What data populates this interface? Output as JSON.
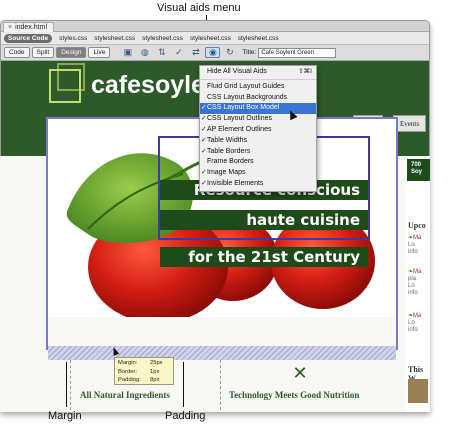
{
  "callouts": {
    "visual_aids_menu": "Visual aids menu",
    "margin": "Margin",
    "padding": "Padding"
  },
  "document": {
    "tab_title": "index.html",
    "related_files": [
      "Source Code",
      "styles.css",
      "stylesheet.css",
      "stylesheet.css",
      "stylesheet.css",
      "stylesheet.css"
    ]
  },
  "toolbar": {
    "code": "Code",
    "split": "Split",
    "design": "Design",
    "live": "Live",
    "title_label": "Title:",
    "title_value": "Cafe Soylent Green"
  },
  "site": {
    "logo": "cafesoyle",
    "nav": [
      "Menu",
      "Events"
    ],
    "headlines": [
      "Resource conscious",
      "haute cuisine",
      "for the 21st Century"
    ],
    "columns": [
      "All Natural Ingredients",
      "Technology Meets Good Nutrition"
    ],
    "sidebar_badge": [
      "700",
      "Soy"
    ],
    "sidebar_heading": "Upco",
    "sidebar_items": [
      {
        "name": "Ma",
        "lines": [
          "Lo",
          "info"
        ]
      },
      {
        "name": "Ma",
        "lines": [
          "pla",
          "Lo",
          "info"
        ]
      },
      {
        "name": "Ma",
        "lines": [
          "Lo",
          "info"
        ]
      }
    ],
    "sidebar_heading2": "This W"
  },
  "visual_aids_menu": {
    "items": [
      {
        "label": "Hide All Visual Aids",
        "checked": false,
        "shortcut": "⇧⌘I",
        "separator_after": true
      },
      {
        "label": "Fluid Grid Layout Guides",
        "checked": false
      },
      {
        "label": "CSS Layout Backgrounds",
        "checked": false
      },
      {
        "label": "CSS Layout Box Model",
        "checked": true,
        "highlight": true
      },
      {
        "label": "CSS Layout Outlines",
        "checked": true
      },
      {
        "label": "AP Element Outlines",
        "checked": true
      },
      {
        "label": "Table Widths",
        "checked": true
      },
      {
        "label": "Table Borders",
        "checked": true
      },
      {
        "label": "Frame Borders",
        "checked": false
      },
      {
        "label": "Image Maps",
        "checked": true
      },
      {
        "label": "Invisible Elements",
        "checked": true
      }
    ]
  },
  "box_model_tooltip": [
    {
      "key": "Margin:",
      "value": "25px"
    },
    {
      "key": "Border:",
      "value": "1px"
    },
    {
      "key": "Padding:",
      "value": "8px"
    }
  ],
  "colors": {
    "header_green": "#2e5a2b",
    "menu_highlight": "#3875d7",
    "outline_purple": "#7b78c9",
    "tomato_red": "#d41e14"
  }
}
